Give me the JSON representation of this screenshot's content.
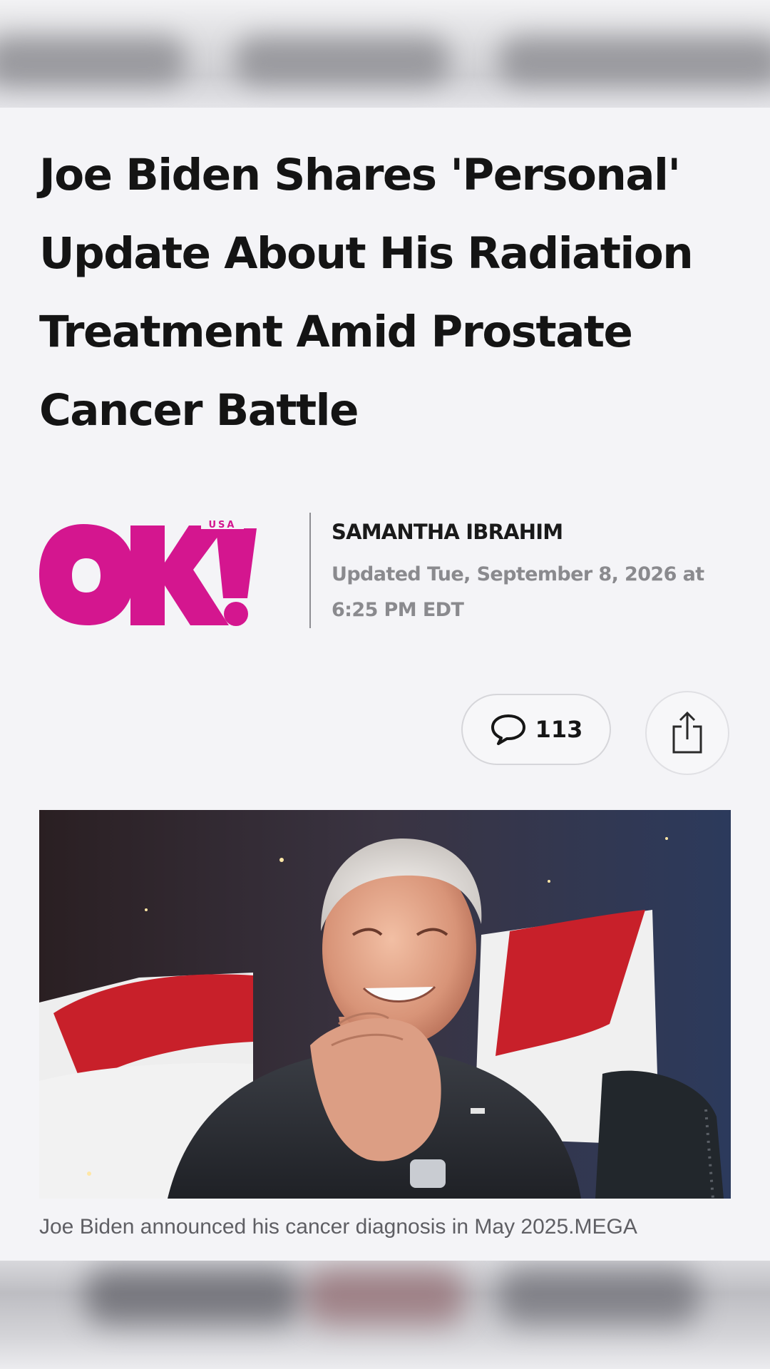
{
  "article": {
    "headline": "Joe Biden Shares 'Personal' Update About His Radiation Treatment Amid Prostate Cancer Battle",
    "author": "SAMANTHA IBRAHIM",
    "updated": "Updated Tue, September 8, 2026 at 6:25 PM EDT",
    "caption": "Joe Biden announced his cancer diagnosis in May 2025.MEGA"
  },
  "publisher": {
    "logo_text": "OK!",
    "logo_sub": "USA",
    "brand_color": "#d4168f"
  },
  "actions": {
    "comment_count": "113",
    "comment_icon": "speech-bubble-icon",
    "share_icon": "share-icon"
  },
  "photo": {
    "subject": "photo-of-joe-biden-clapping",
    "flag_colors": [
      "#c8202a",
      "#f3f3f3"
    ]
  }
}
